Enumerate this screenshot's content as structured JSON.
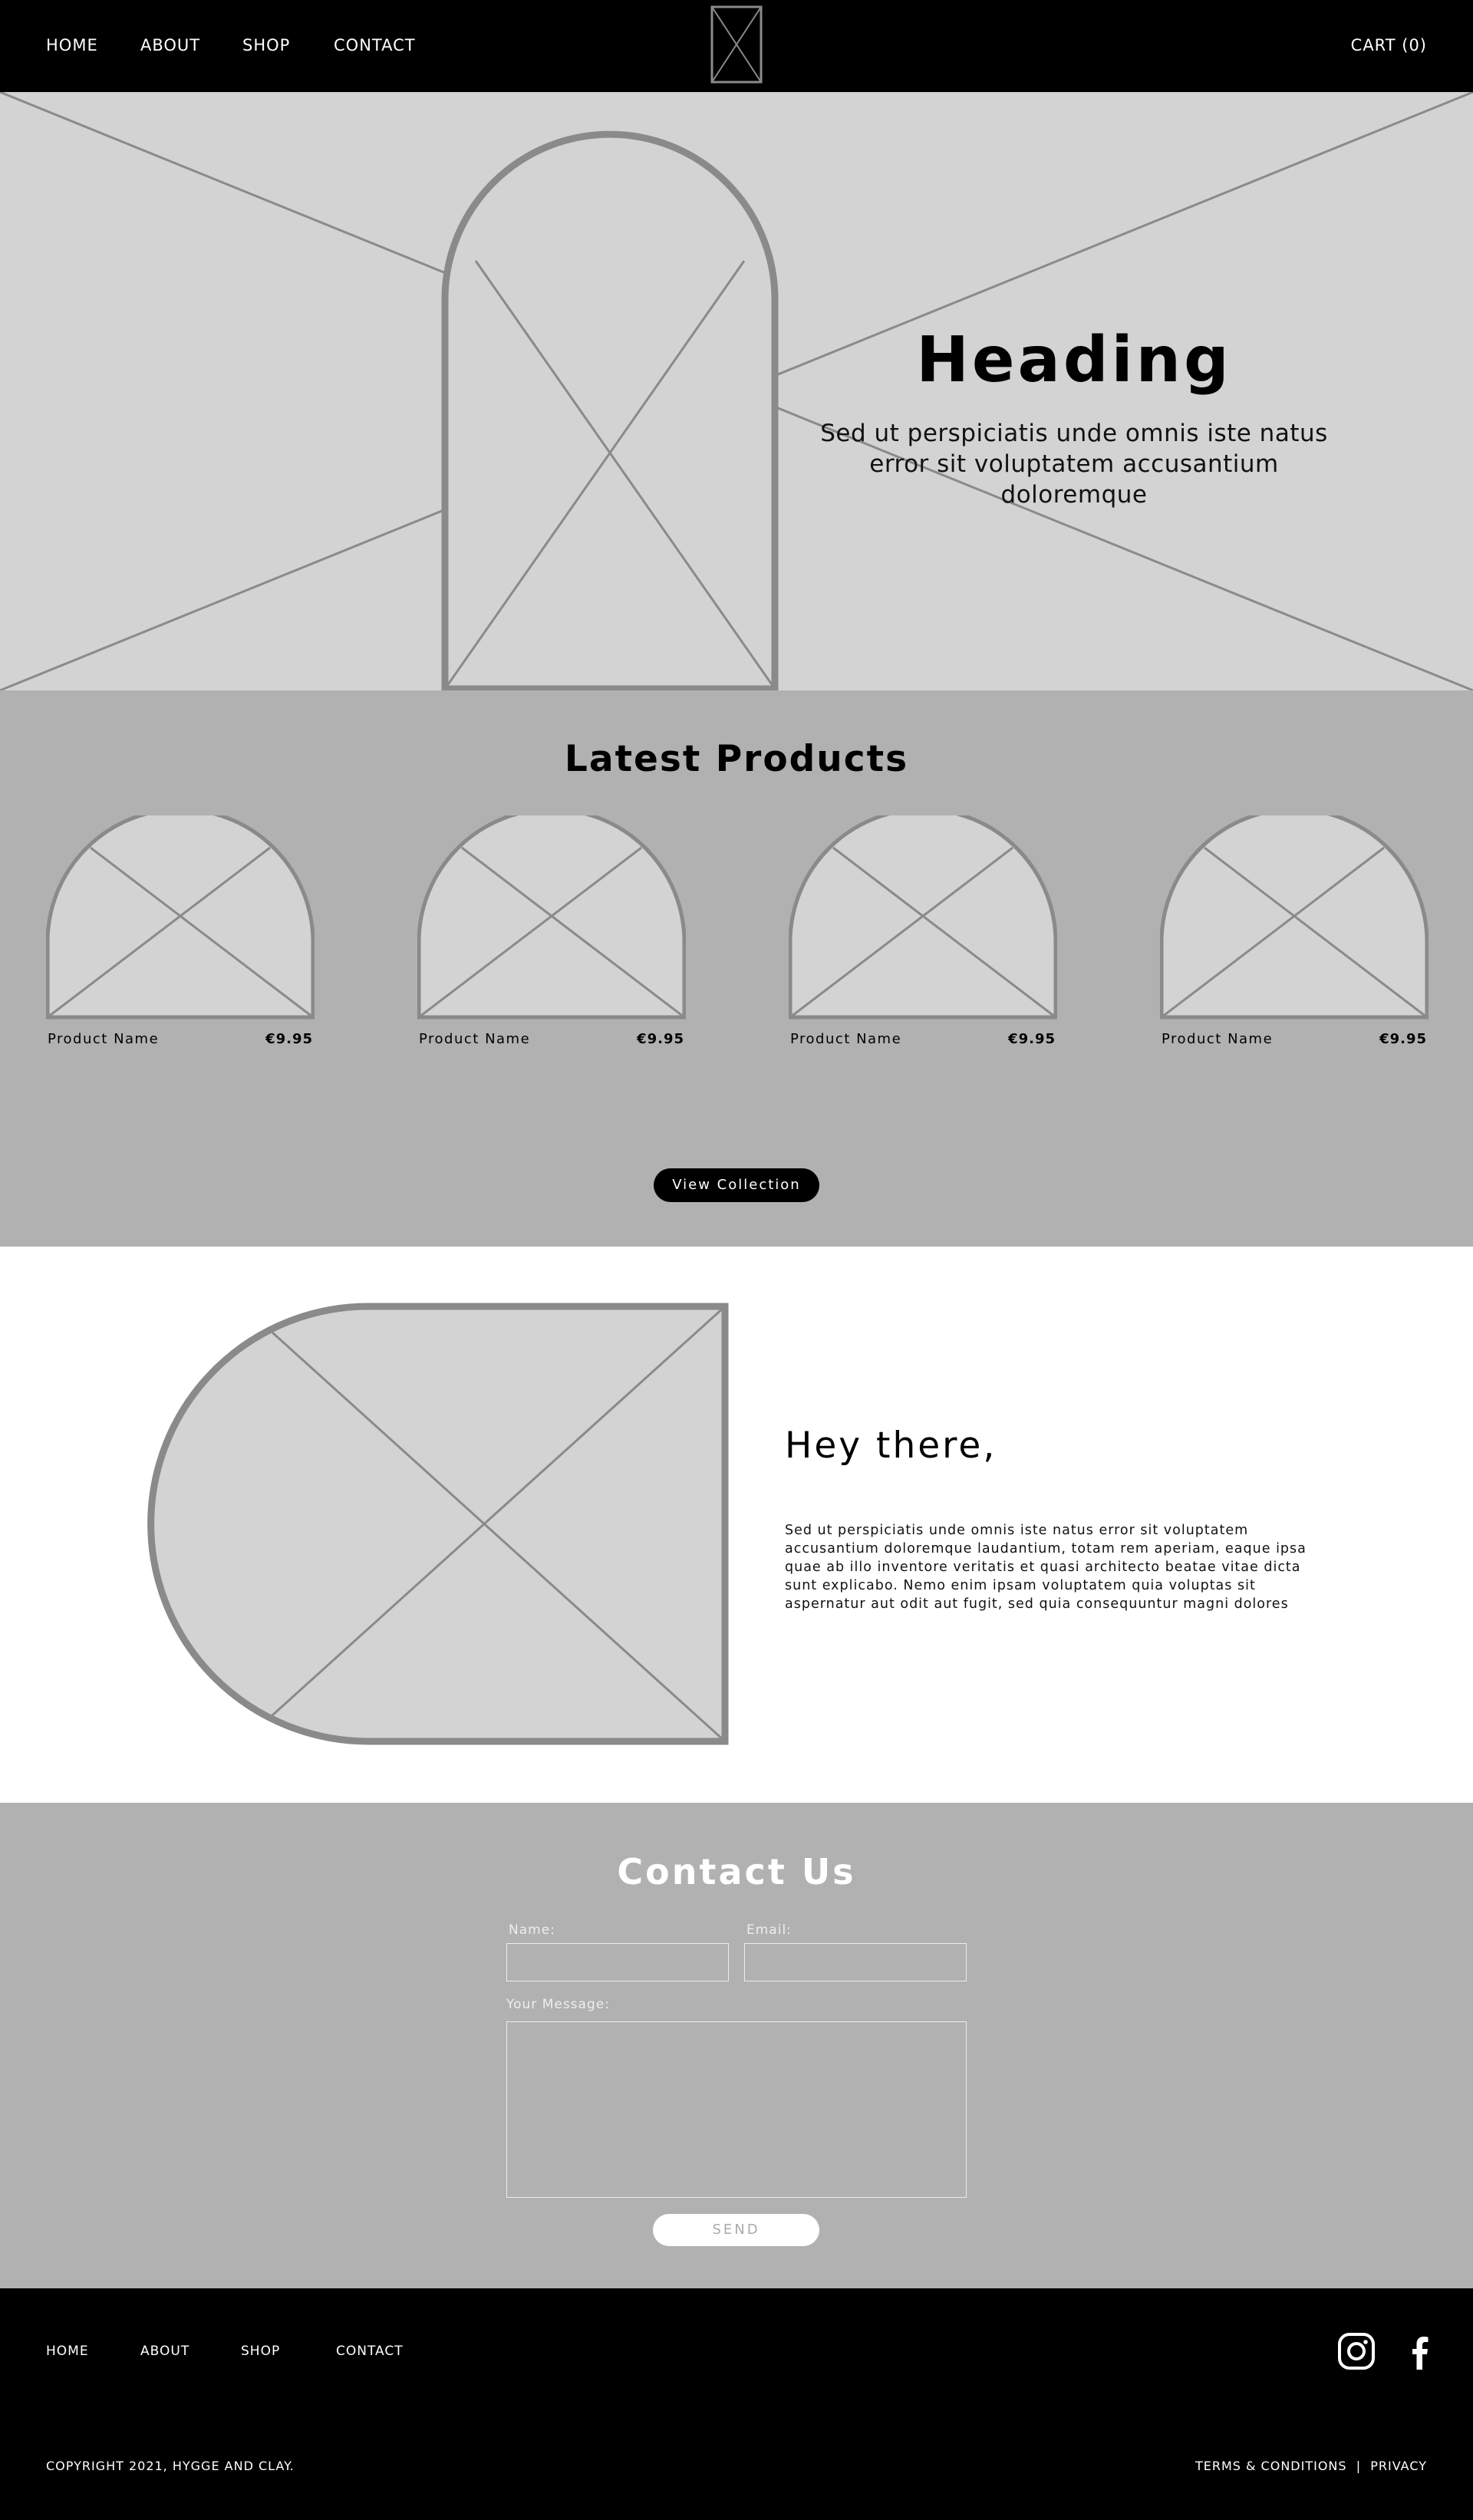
{
  "nav": {
    "home": "HOME",
    "about": "ABOUT",
    "shop": "SHOP",
    "contact": "CONTACT",
    "cart": "CART (0)"
  },
  "hero": {
    "heading": "Heading",
    "subheading": "Sed ut perspiciatis unde omnis iste natus error sit voluptatem accusantium doloremque"
  },
  "products": {
    "title": "Latest Products",
    "items": [
      {
        "name": "Product Name",
        "price": "€9.95"
      },
      {
        "name": "Product Name",
        "price": "€9.95"
      },
      {
        "name": "Product Name",
        "price": "€9.95"
      },
      {
        "name": "Product Name",
        "price": "€9.95"
      }
    ],
    "button": "View Collection"
  },
  "about": {
    "heading": "Hey there,",
    "body": "Sed ut perspiciatis unde omnis iste natus error sit voluptatem accusantium doloremque laudantium, totam rem aperiam, eaque ipsa quae ab illo inventore veritatis et quasi architecto beatae vitae dicta sunt explicabo. Nemo enim ipsam voluptatem quia voluptas sit aspernatur aut odit aut fugit, sed quia consequuntur magni dolores"
  },
  "contact": {
    "title": "Contact Us",
    "name_label": "Name:",
    "email_label": "Email:",
    "message_label": "Your Message:",
    "send": "SEND"
  },
  "footer": {
    "home": "HOME",
    "about": "ABOUT",
    "shop": "SHOP",
    "contact": "CONTACT",
    "copyright": "COPYRIGHT 2021, HYGGE AND CLAY.",
    "terms": "TERMS & CONDITIONS",
    "separator": "|",
    "privacy": "PRIVACY",
    "social_icons": [
      "instagram-icon",
      "facebook-icon"
    ]
  },
  "colors": {
    "header_bg": "#000000",
    "hero_bg": "#d3d3d3",
    "section_gray": "#b1b1b1",
    "placeholder_stroke": "#8a8a8a"
  }
}
